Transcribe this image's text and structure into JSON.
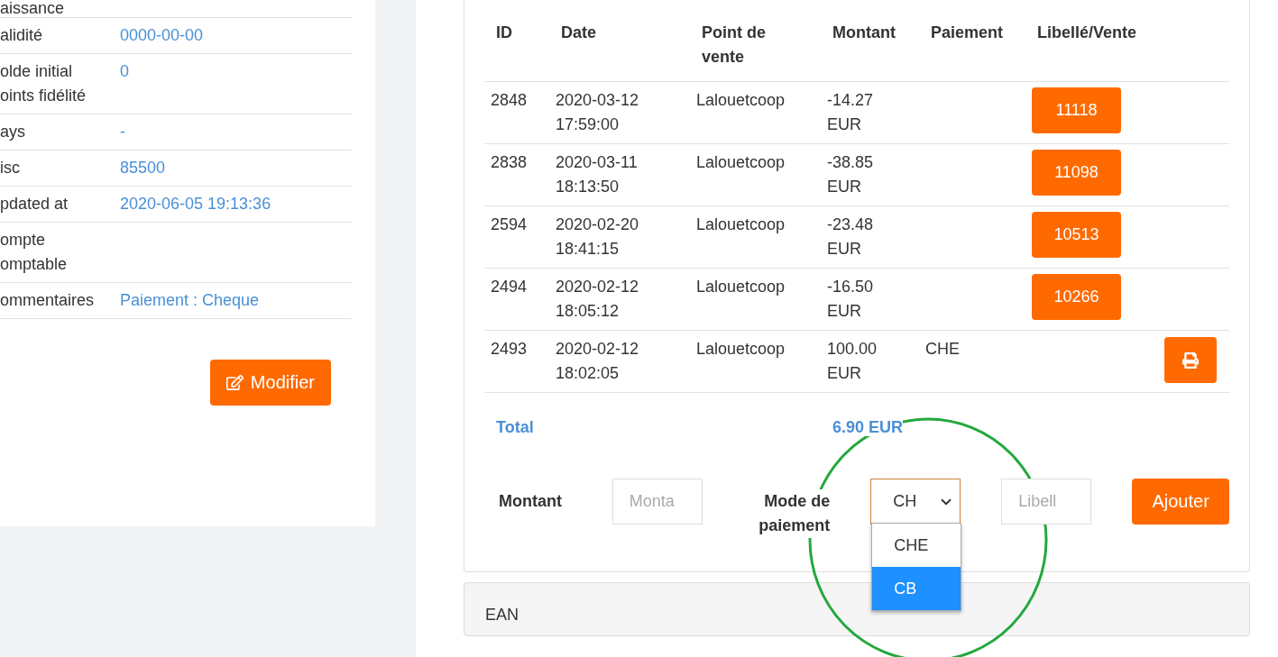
{
  "details": [
    {
      "label_lines": [
        "aissance"
      ]
    },
    {
      "label_lines": [
        "alidité"
      ],
      "value": "0000-00-00"
    },
    {
      "label_lines": [
        "olde initial",
        "oints fidélité"
      ],
      "value": "0"
    },
    {
      "label_lines": [
        "ays"
      ],
      "value": "-"
    },
    {
      "label_lines": [
        "isc"
      ],
      "value": "85500"
    },
    {
      "label_lines": [
        "pdated at"
      ],
      "value": "2020-06-05 19:13:36"
    },
    {
      "label_lines": [
        "ompte",
        "omptable"
      ]
    },
    {
      "label_lines": [
        "ommentaires"
      ],
      "value": "Paiement : Cheque"
    }
  ],
  "edit_button": "Modifier",
  "table": {
    "columns": [
      "ID",
      "Date",
      "Point de vente",
      "Montant",
      "Paiement",
      "Libellé/Vente"
    ],
    "rows": [
      {
        "id": "2848",
        "date": "2020-03-12 17:59:00",
        "point": "Lalouetcoop",
        "amount": "-14.27 EUR",
        "kind": "sale",
        "sale": "11118"
      },
      {
        "id": "2838",
        "date": "2020-03-11 18:13:50",
        "point": "Lalouetcoop",
        "amount": "-38.85 EUR",
        "kind": "sale",
        "sale": "11098"
      },
      {
        "id": "2594",
        "date": "2020-02-20 18:41:15",
        "point": "Lalouetcoop",
        "amount": "-23.48 EUR",
        "kind": "sale",
        "sale": "10513"
      },
      {
        "id": "2494",
        "date": "2020-02-12 18:05:12",
        "point": "Lalouetcoop",
        "amount": "-16.50 EUR",
        "kind": "sale",
        "sale": "10266"
      },
      {
        "id": "2493",
        "date": "2020-02-12 18:02:05",
        "point": "Lalouetcoop",
        "amount": "100.00 EUR",
        "payment": "CHE",
        "kind": "print"
      }
    ],
    "total_label": "Total",
    "total_value": "6.90 EUR"
  },
  "form": {
    "amount_label": "Montant",
    "amount_placeholder": "Monta",
    "mode_label": "Mode de paiement",
    "mode_value": "CH",
    "mode_options": [
      {
        "label": "CHE",
        "selected": false
      },
      {
        "label": "CB",
        "selected": true
      }
    ],
    "label_placeholder": "Libell",
    "add_button": "Ajouter"
  },
  "ean_panel": {
    "title": "EAN"
  }
}
